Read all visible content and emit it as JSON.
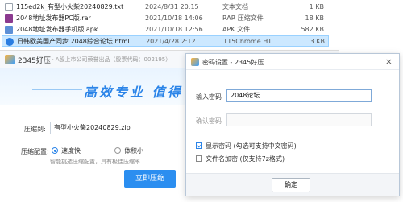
{
  "files": [
    {
      "name": "115ed2k_有型小火柴20240829.txt",
      "date": "2024/8/31 20:15",
      "type": "文本文档",
      "size": "1 KB",
      "icon": "text-file-icon",
      "color": "#ffffff",
      "selected": false
    },
    {
      "name": "2048地址发布器PC版.rar",
      "date": "2021/10/18 14:06",
      "type": "RAR 压缩文件",
      "size": "18 KB",
      "icon": "rar-file-icon",
      "color": "#8b3a8f",
      "selected": false
    },
    {
      "name": "2048地址发布器手机版.apk",
      "date": "2021/10/18 12:56",
      "type": "APK 文件",
      "size": "582 KB",
      "icon": "apk-file-icon",
      "color": "#5c8fd6",
      "selected": false
    },
    {
      "name": "日韩欧美国产同步 2048综合论坛.html",
      "date": "2021/4/28 2:12",
      "type": "115Chrome HT...",
      "size": "3 KB",
      "icon": "html-file-icon",
      "color": "#2a7de1",
      "selected": true
    }
  ],
  "main": {
    "app_name": "2345好压",
    "app_sub": "- A股上市公司荣誉出品（股票代码：002195）",
    "slogan": "高效专业  值得",
    "path_label": "压缩到:",
    "path_value": "有型小火柴20240829.zip",
    "config_label": "压缩配置:",
    "opt_fast": "速度快",
    "opt_small": "体积小",
    "hint": "智能挑选压缩配置，具有极佳压缩率",
    "zip_button": "立即压缩"
  },
  "dialog": {
    "title": "密码设置 - 2345好压",
    "close": "×",
    "password_label": "输入密码",
    "password_value": "2048论坛",
    "confirm_label": "确认密码",
    "confirm_value": "",
    "show_password": "显示密码 (勾选可支持中文密码)",
    "encrypt_names": "文件名加密 (仅支持7z格式)",
    "ok": "确定"
  }
}
